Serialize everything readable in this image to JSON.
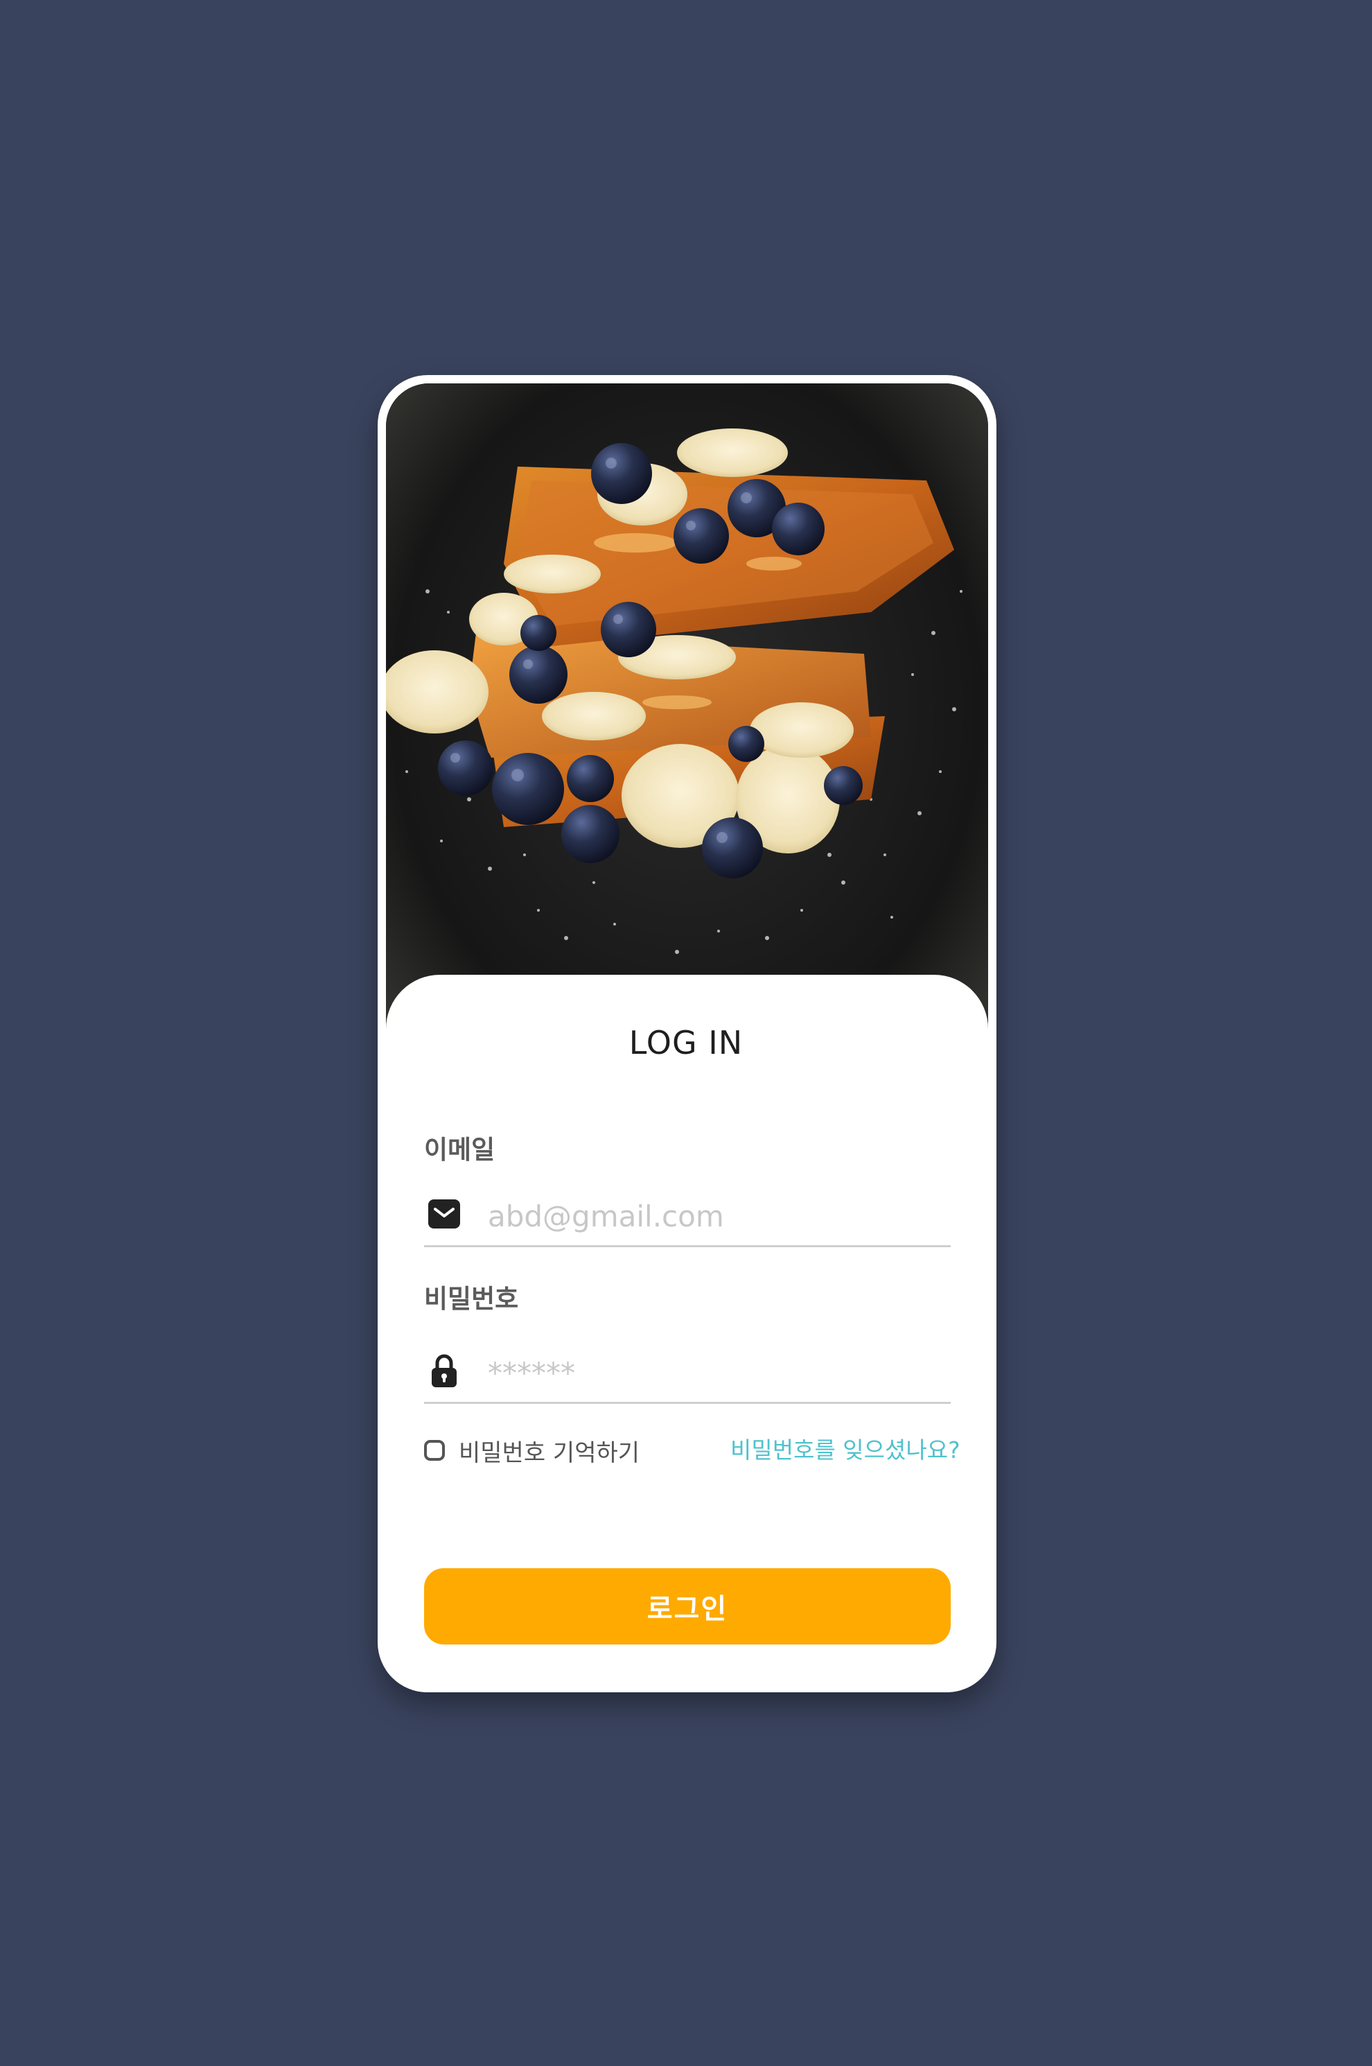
{
  "colors": {
    "background": "#3a435e",
    "card": "#ffffff",
    "accent": "#ffaa00",
    "link": "#4ec2cd",
    "label": "#5b5b5b"
  },
  "hero": {
    "image": "french-toast-with-banana-and-blueberries-photo"
  },
  "login": {
    "title": "LOG IN",
    "email": {
      "label": "이메일",
      "icon": "envelope-icon",
      "placeholder": "abd@gmail.com"
    },
    "password": {
      "label": "비밀번호",
      "icon": "lock-icon",
      "placeholder": "******"
    },
    "remember_label": "비밀번호 기억하기",
    "remember_checked": false,
    "forgot_link": "비밀번호를 잊으셨나요?",
    "submit_label": "로그인"
  }
}
